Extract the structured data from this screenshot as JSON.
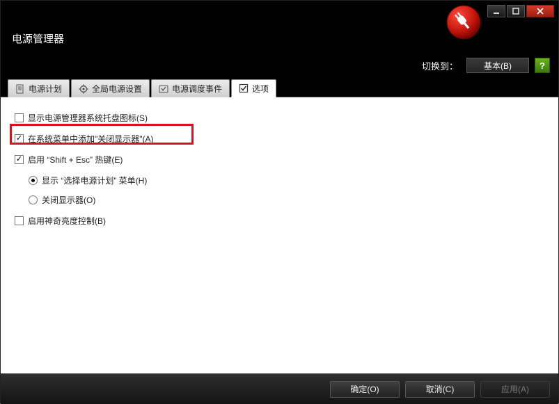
{
  "title": "电源管理器",
  "toolbar": {
    "switch_label": "切换到：",
    "basic_button": "基本(B)"
  },
  "tabs": [
    {
      "label": "电源计划"
    },
    {
      "label": "全局电源设置"
    },
    {
      "label": "电源调度事件"
    },
    {
      "label": "选项"
    }
  ],
  "options": {
    "show_tray_icon": {
      "label": "显示电源管理器系统托盘图标(S)",
      "checked": false
    },
    "add_turnoff_display": {
      "label": "在系统菜单中添加\"关闭显示器\"(A)",
      "checked": true
    },
    "enable_shift_esc": {
      "label": "启用 “Shift + Esc” 热键(E)",
      "checked": true
    },
    "hotkey_radio": {
      "show_plan_menu": {
        "label": "显示 “选择电源计划” 菜单(H)",
        "selected": true
      },
      "turn_off_display": {
        "label": "关闭显示器(O)",
        "selected": false
      }
    },
    "magic_brightness": {
      "label": "启用神奇亮度控制(B)",
      "checked": false
    }
  },
  "footer": {
    "ok": "确定(O)",
    "cancel": "取消(C)",
    "apply": "应用(A)"
  }
}
